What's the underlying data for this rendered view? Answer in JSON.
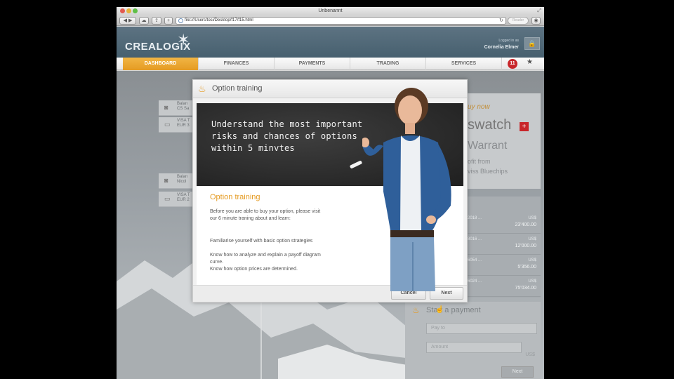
{
  "window": {
    "title": "Unbenannt",
    "url": "file:///Users/tosi/Desktop/f17/f15.html",
    "reader_label": "Reader"
  },
  "header": {
    "logo": "CREALOGIX",
    "logged_in_label": "Logged in as",
    "user_name": "Cornelia Elmer"
  },
  "nav": {
    "items": [
      {
        "label": "DASHBOARD",
        "active": true
      },
      {
        "label": "FINANCES",
        "active": false
      },
      {
        "label": "PAYMENTS",
        "active": false
      },
      {
        "label": "TRADING",
        "active": false
      },
      {
        "label": "SERVICES",
        "active": false
      }
    ],
    "badge_count": "11"
  },
  "accounts": [
    {
      "line1": "Balan",
      "line2": "CS Sa"
    },
    {
      "line1": "VISA T",
      "line2": "EUR 3"
    },
    {
      "line1": "Balan",
      "line2": "Nicol"
    },
    {
      "line1": "VISA T",
      "line2": "EUR 2"
    }
  ],
  "ad": {
    "line1": "uy now",
    "brand": "swatch",
    "plus": "+",
    "warrant": "Warrant",
    "sub1": "ofit from",
    "sub2": "viss Bluechips"
  },
  "transactions": [
    {
      "date": "2018 ...",
      "currency": "US$",
      "amount": "23'400.00"
    },
    {
      "date": "8016 ...",
      "currency": "US$",
      "amount": "12'000.00"
    },
    {
      "date": "6054 ...",
      "currency": "US$",
      "amount": "5'356.00"
    },
    {
      "date": "6024 ...",
      "currency": "US$",
      "amount": "75'034.00"
    }
  ],
  "payment": {
    "title": "Start a payment",
    "to_placeholder": "Pay to",
    "amount_placeholder": "Amount",
    "currency": "US$",
    "next_label": "Next"
  },
  "modal": {
    "title": "Option training",
    "board_text": "Understand the most important risks and chances of options within 5 minvtes",
    "training_title": "Option training",
    "intro": "Before you are able to buy your option, please visit our 6 minute traning about and learn:",
    "goals": [
      "Familiarise yourself with basic option strategies",
      "Know how to analyze and explain a payoff diagram curve.",
      "Know how option prices are determined."
    ],
    "cancel_label": "Cancel",
    "next_label": "Next"
  },
  "colors": {
    "accent": "#e59b22",
    "header": "#516a79",
    "badge": "#c8262a"
  }
}
